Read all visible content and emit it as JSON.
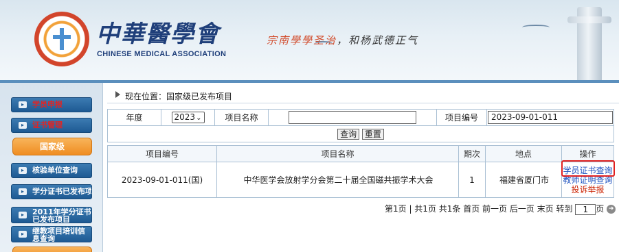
{
  "header": {
    "logo_cn": "中華醫學會",
    "logo_en": "CHINESE MEDICAL ASSOCIATION",
    "slogan_red": "宗南學學圣治",
    "slogan_black": "，和杨武德正气"
  },
  "sidebar": {
    "items": [
      {
        "label": "学员申报",
        "color": "#e02424"
      },
      {
        "label": "证书管理",
        "color": "#e02424"
      },
      {
        "label": "国家级",
        "active": true
      },
      {
        "label": "核验单位查询"
      },
      {
        "label": "学分证书已发布项"
      },
      {
        "label": "2011年学分证书已发布项目"
      },
      {
        "label": "继教项目培训信息查询"
      }
    ]
  },
  "breadcrumb": "现在位置：国家级已发布项目",
  "filter": {
    "year_label": "年度",
    "year_value": "2023",
    "name_label": "项目名称",
    "name_value": "",
    "code_label": "项目编号",
    "code_value": "2023-09-01-011",
    "query_button": "查询",
    "reset_button": "重置"
  },
  "results": {
    "headers": [
      "项目编号",
      "项目名称",
      "期次",
      "地点",
      "操作"
    ],
    "rows": [
      {
        "code": "2023-09-01-011(国)",
        "name": "中华医学会放射学分会第二十届全国磁共振学术大会",
        "session": "1",
        "location": "福建省厦门市",
        "actions": [
          "学员证书查询",
          "教师证明查询",
          "投诉举报"
        ]
      }
    ]
  },
  "pager": {
    "text": "第1页 | 共1页 共1条  首页 前一页 后一页 末页  转到",
    "page_value": "1",
    "suffix": "页"
  },
  "colors": {
    "highlight": "#e02020",
    "link_red": "#cc2200",
    "link_blue": "#1a4fbf",
    "sidebar_btn": "#1e5a93",
    "active_btn": "#ef8d22"
  }
}
